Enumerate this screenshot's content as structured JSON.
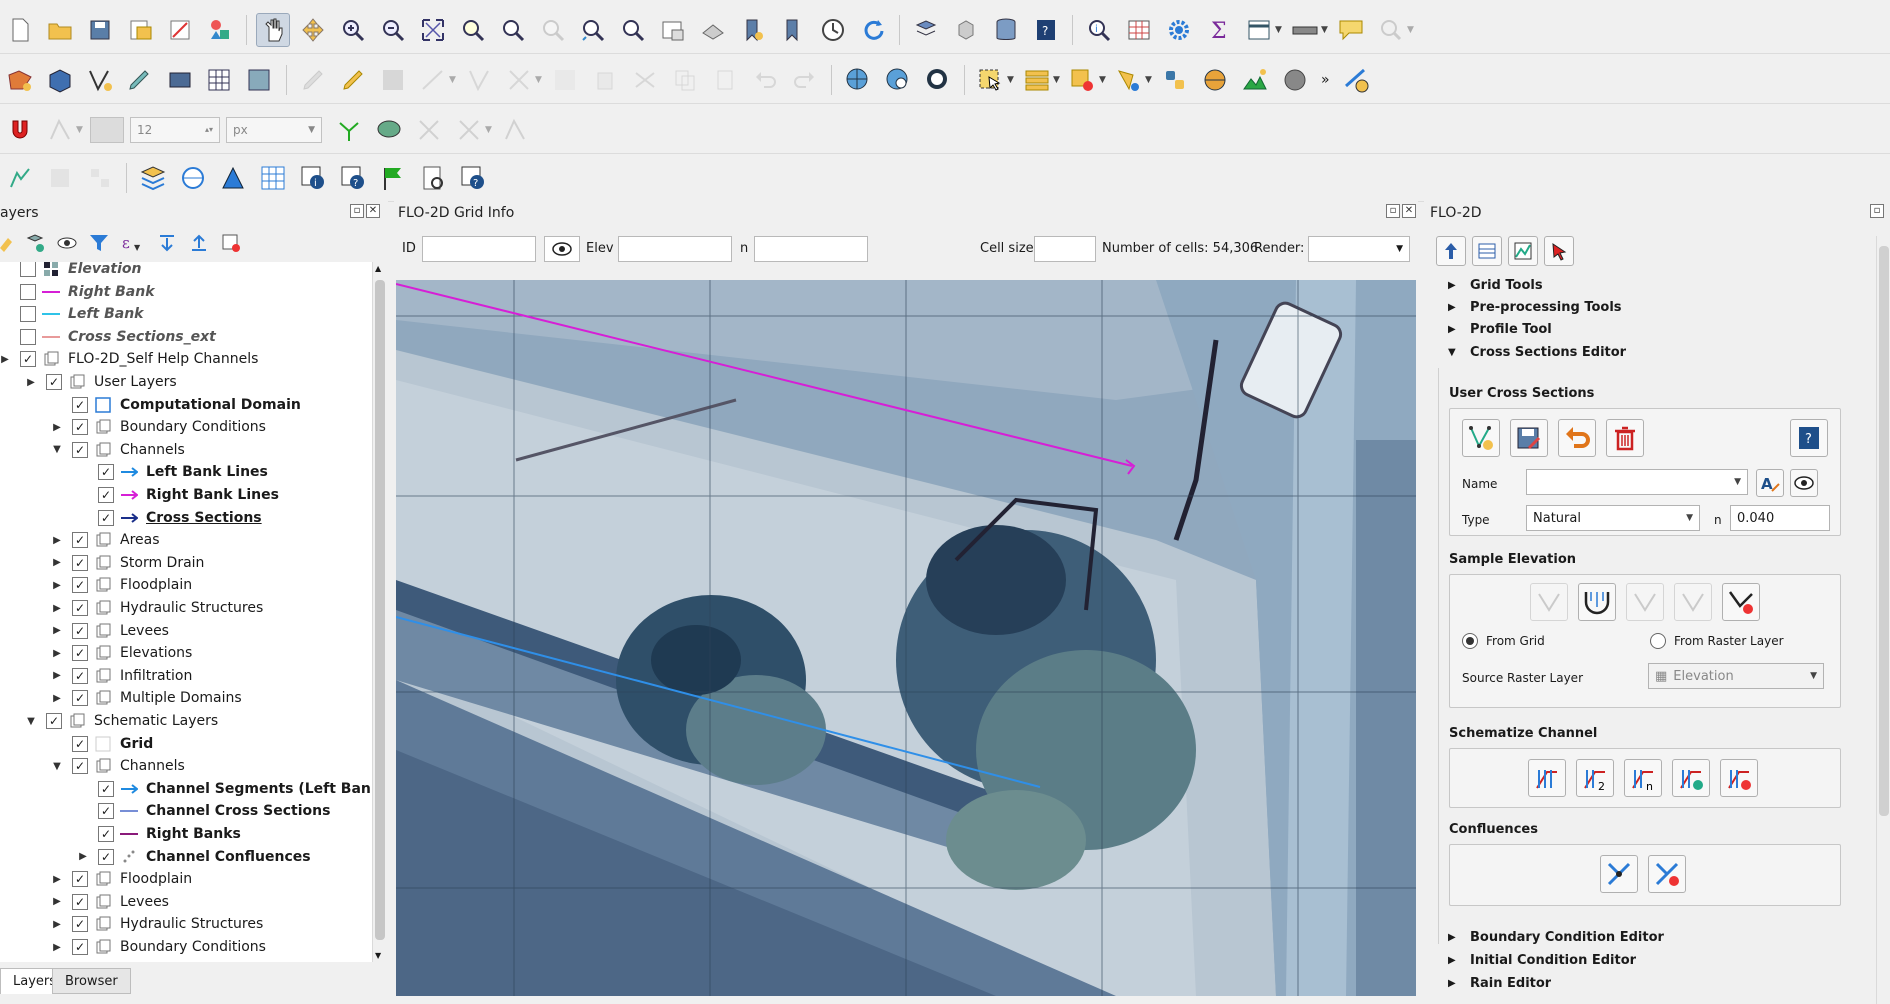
{
  "layers_panel": {
    "title": "ayers",
    "tabs": [
      "Layers",
      "Browser"
    ],
    "rows": [
      {
        "label": "Elevation",
        "style": "italic",
        "icon": "raster-icon"
      },
      {
        "label": "Right Bank",
        "style": "italic",
        "icon": "magenta-line-icon"
      },
      {
        "label": "Left Bank",
        "style": "italic",
        "icon": "cyan-line-icon"
      },
      {
        "label": "Cross Sections_ext",
        "style": "italic",
        "icon": "pink-line-icon"
      },
      {
        "label": "FLO-2D_Self Help Channels",
        "style": "normal",
        "icon": "group-icon"
      },
      {
        "label": "User Layers",
        "style": "normal",
        "icon": "group-icon"
      },
      {
        "label": "Computational Domain",
        "style": "bold",
        "icon": "polygon-icon"
      },
      {
        "label": "Boundary Conditions",
        "style": "normal",
        "icon": "group-icon"
      },
      {
        "label": "Channels",
        "style": "normal",
        "icon": "group-icon"
      },
      {
        "label": "Left Bank Lines",
        "style": "bold",
        "icon": "blue-arrow-icon"
      },
      {
        "label": "Right Bank Lines",
        "style": "bold",
        "icon": "magenta-arrow-icon"
      },
      {
        "label": "Cross Sections",
        "style": "bold-underline",
        "icon": "navy-arrow-icon"
      },
      {
        "label": "Areas",
        "style": "normal",
        "icon": "group-icon"
      },
      {
        "label": "Storm Drain",
        "style": "normal",
        "icon": "group-icon"
      },
      {
        "label": "Floodplain",
        "style": "normal",
        "icon": "group-icon"
      },
      {
        "label": "Hydraulic Structures",
        "style": "normal",
        "icon": "group-icon"
      },
      {
        "label": "Levees",
        "style": "normal",
        "icon": "group-icon"
      },
      {
        "label": "Elevations",
        "style": "normal",
        "icon": "group-icon"
      },
      {
        "label": "Infiltration",
        "style": "normal",
        "icon": "group-icon"
      },
      {
        "label": "Multiple Domains",
        "style": "normal",
        "icon": "group-icon"
      },
      {
        "label": "Schematic Layers",
        "style": "normal",
        "icon": "group-icon"
      },
      {
        "label": "Grid",
        "style": "bold",
        "icon": "grid-layer-icon"
      },
      {
        "label": "Channels",
        "style": "normal",
        "icon": "group-icon"
      },
      {
        "label": "Channel Segments (Left Banks)",
        "style": "bold",
        "icon": "blue-arrow-icon"
      },
      {
        "label": "Channel Cross Sections",
        "style": "bold",
        "icon": "blue-line-icon"
      },
      {
        "label": "Right Banks",
        "style": "bold",
        "icon": "purple-line-icon"
      },
      {
        "label": "Channel Confluences",
        "style": "bold",
        "icon": "points-icon"
      },
      {
        "label": "Floodplain",
        "style": "normal",
        "icon": "group-icon"
      },
      {
        "label": "Levees",
        "style": "normal",
        "icon": "group-icon"
      },
      {
        "label": "Hydraulic Structures",
        "style": "normal",
        "icon": "group-icon"
      },
      {
        "label": "Boundary Conditions",
        "style": "normal",
        "icon": "group-icon"
      }
    ]
  },
  "toolbar": {
    "font_size_value": "12",
    "unit_value": "px"
  },
  "grid_info": {
    "title": "FLO-2D Grid Info",
    "id_label": "ID",
    "elev_label": "Elev",
    "n_label": "n",
    "cell_size_label": "Cell size",
    "num_cells": "Number of cells: 54,306",
    "render_label": "Render:"
  },
  "flo2d": {
    "title": "FLO-2D",
    "sections_top": [
      "Grid Tools",
      "Pre-processing Tools",
      "Profile Tool",
      "Cross Sections Editor"
    ],
    "sections_bottom": [
      "Boundary Condition Editor",
      "Initial Condition Editor",
      "Rain Editor"
    ],
    "user_cross_sections": "User Cross Sections",
    "name_label": "Name",
    "type_label": "Type",
    "type_value": "Natural",
    "n_label": "n",
    "n_value": "0.040",
    "sample_elevation": "Sample Elevation",
    "from_grid": "From Grid",
    "from_raster": "From Raster Layer",
    "source_raster_label": "Source Raster Layer",
    "source_raster_value": "Elevation",
    "schematize_channel": "Schematize Channel",
    "confluences": "Confluences"
  },
  "colors": {
    "right_bank": "#d61fd6",
    "left_bank": "#2f8fe8",
    "accent": "#1a5fb4"
  }
}
